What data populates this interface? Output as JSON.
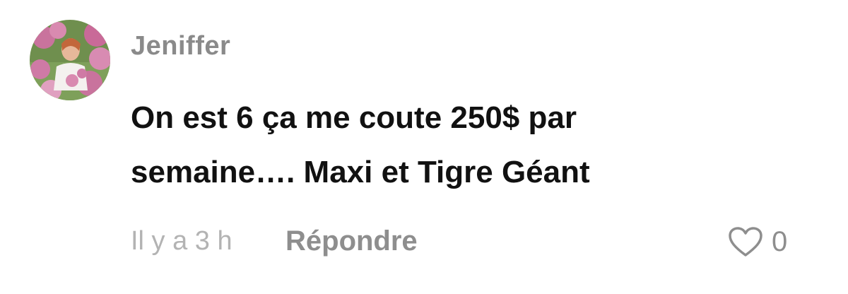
{
  "comment": {
    "username": "Jeniffer",
    "text_line_1": "On est 6 ça me coute 250$ par",
    "text_line_2": "semaine…. Maxi et Tigre Géant",
    "timestamp": "Il y a 3 h",
    "reply_label": "Répondre",
    "like_count": "0",
    "avatar_icon": "user-avatar-photo",
    "like_icon": "heart-outline-icon"
  },
  "colors": {
    "username": "#8a8a8a",
    "text": "#111111",
    "timestamp": "#b3b3b3",
    "action": "#8e8e8e"
  }
}
